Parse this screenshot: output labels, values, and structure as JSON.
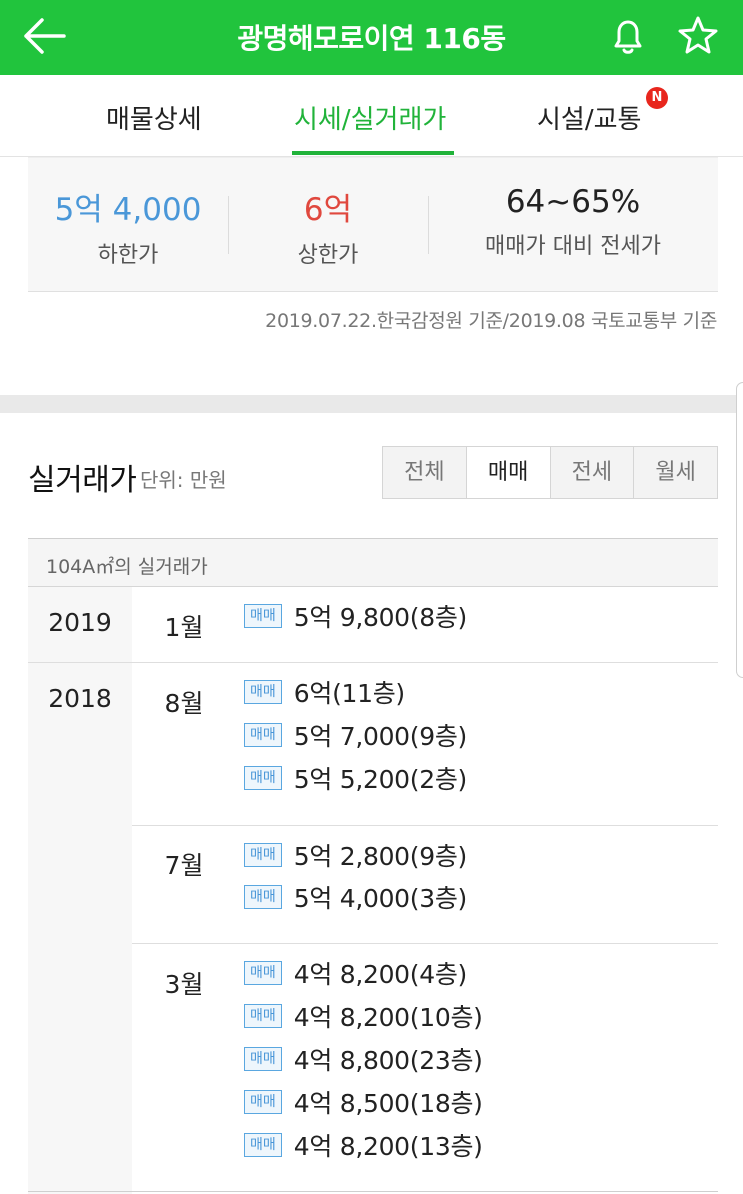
{
  "appbar": {
    "title": "광명해모로이연 116동",
    "back_icon": "arrow-left-icon",
    "bell_icon": "bell-icon",
    "star_icon": "star-icon"
  },
  "tabs": [
    {
      "label": "매물상세",
      "active": false
    },
    {
      "label": "시세/실거래가",
      "active": true
    },
    {
      "label": "시설/교통",
      "active": false
    }
  ],
  "new_badge": "N",
  "summary": {
    "low": {
      "value": "5억 4,000",
      "label": "하한가",
      "color": "#4a97d8"
    },
    "high": {
      "value": "6억",
      "label": "상한가",
      "color": "#e0483e"
    },
    "ratio": {
      "value": "64~65%",
      "label": "매매가 대비 전세가",
      "color": "#222222"
    }
  },
  "basis_text": "2019.07.22.한국감정원 기준/2019.08 국토교통부 기준",
  "real_trade": {
    "title": "실거래가",
    "unit": "단위: 만원",
    "filters": [
      {
        "label": "전체",
        "active": false
      },
      {
        "label": "매매",
        "active": true
      },
      {
        "label": "전세",
        "active": false
      },
      {
        "label": "월세",
        "active": false
      }
    ],
    "table_title": "104A㎡의 실거래가",
    "tag_label": "매매",
    "years": [
      {
        "year": "2019",
        "months": [
          {
            "month": "1월",
            "prices": [
              "5억 9,800(8층)"
            ]
          }
        ]
      },
      {
        "year": "2018",
        "months": [
          {
            "month": "8월",
            "prices": [
              "6억(11층)",
              "5억 7,000(9층)",
              "5억 5,200(2층)"
            ]
          },
          {
            "month": "7월",
            "prices": [
              "5억 2,800(9층)",
              "5억 4,000(3층)"
            ]
          },
          {
            "month": "3월",
            "prices": [
              "4억 8,200(4층)",
              "4억 8,200(10층)",
              "4억 8,800(23층)",
              "4억 8,500(18층)",
              "4억 8,200(13층)"
            ]
          }
        ]
      }
    ]
  }
}
